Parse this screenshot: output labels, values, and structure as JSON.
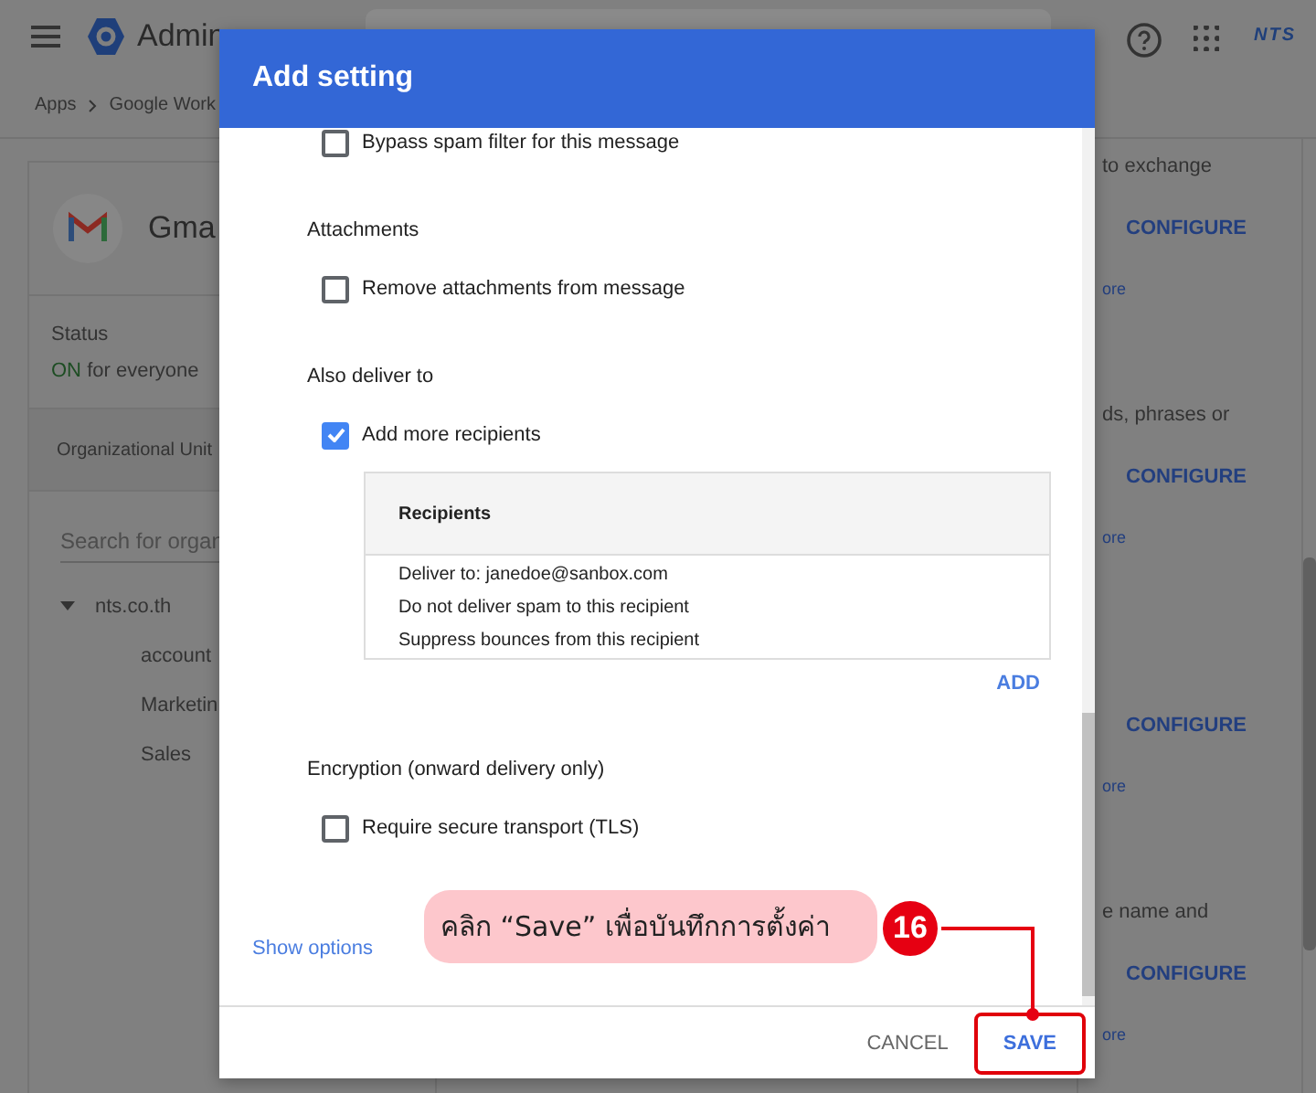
{
  "app_bar": {
    "title": "Admin",
    "brand": "NTS"
  },
  "breadcrumb": [
    "Apps",
    "Google Work"
  ],
  "app_card": {
    "name": "Gma",
    "status_label": "Status",
    "status_value": "ON",
    "status_text": "for everyone",
    "ou_header": "Organizational Unit",
    "search": {
      "placeholder": "Search for organ"
    },
    "tree": [
      {
        "label": "nts.co.th",
        "expanded": true,
        "children": [
          {
            "label": "account"
          },
          {
            "label": "Marketin"
          },
          {
            "label": "Sales"
          }
        ]
      }
    ]
  },
  "settings": [
    {
      "description": "to exchange",
      "action": "CONFIGURE",
      "link": "ore"
    },
    {
      "description": "ds, phrases or",
      "action": "CONFIGURE",
      "link": "ore"
    },
    {
      "action": "CONFIGURE",
      "link": "ore"
    },
    {
      "description": "e name and",
      "action": "CONFIGURE",
      "link": "ore"
    }
  ],
  "dialog": {
    "title": "Add setting",
    "items": [
      {
        "kind": "checkbox",
        "label": "Bypass spam filter for this message",
        "checked": false
      },
      {
        "kind": "heading",
        "label": "Attachments"
      },
      {
        "kind": "checkbox",
        "label": "Remove attachments from message",
        "checked": false
      },
      {
        "kind": "heading",
        "label": "Also deliver to"
      },
      {
        "kind": "checkbox",
        "label": "Add more recipients",
        "checked": true
      },
      {
        "kind": "table",
        "header": "Recipients",
        "rows": [
          "Deliver to: janedoe@sanbox.com",
          "Do not deliver spam to this recipient",
          "Suppress bounces from this recipient"
        ]
      },
      {
        "kind": "button",
        "label": "ADD"
      },
      {
        "kind": "heading",
        "label": "Encryption (onward delivery only)"
      },
      {
        "kind": "checkbox",
        "label": "Require secure transport (TLS)",
        "checked": false
      },
      {
        "kind": "link",
        "label": "Show options"
      }
    ],
    "buttons": [
      {
        "label": "CANCEL",
        "primary": false
      },
      {
        "label": "SAVE",
        "primary": true
      }
    ]
  },
  "annotation": {
    "text": "คลิก “Save” เพื่อบันทึกการตั้งค่า",
    "step": "16"
  }
}
